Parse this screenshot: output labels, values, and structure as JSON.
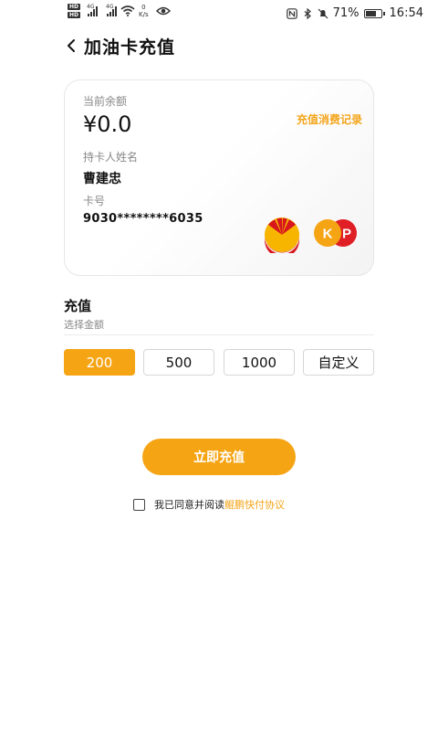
{
  "status_bar": {
    "hd_labels": [
      "HD",
      "HD"
    ],
    "net_speed_value": "0",
    "net_speed_unit": "K/s",
    "battery": "71%",
    "time": "16:54"
  },
  "header": {
    "title": "加油卡充值"
  },
  "card": {
    "balance_label": "当前余额",
    "balance_value": "¥0.0",
    "record_link": "充值消费记录",
    "holder_label": "持卡人姓名",
    "holder_name": "曹建忠",
    "number_label": "卡号",
    "card_number": "9030********6035",
    "kp_logo_text": {
      "k": "K",
      "p": "P"
    }
  },
  "recharge": {
    "title": "充值",
    "subtitle": "选择金额",
    "amounts": [
      "200",
      "500",
      "1000",
      "自定义"
    ],
    "selected_index": 0,
    "submit_label": "立即充值"
  },
  "agreement": {
    "text": "我已同意并阅读",
    "link": "鲲鹏快付协议",
    "checked": false
  },
  "colors": {
    "accent": "#f5a414",
    "link": "#f4a51b",
    "petro_red": "#d7161e",
    "petro_yellow": "#f7b500"
  }
}
